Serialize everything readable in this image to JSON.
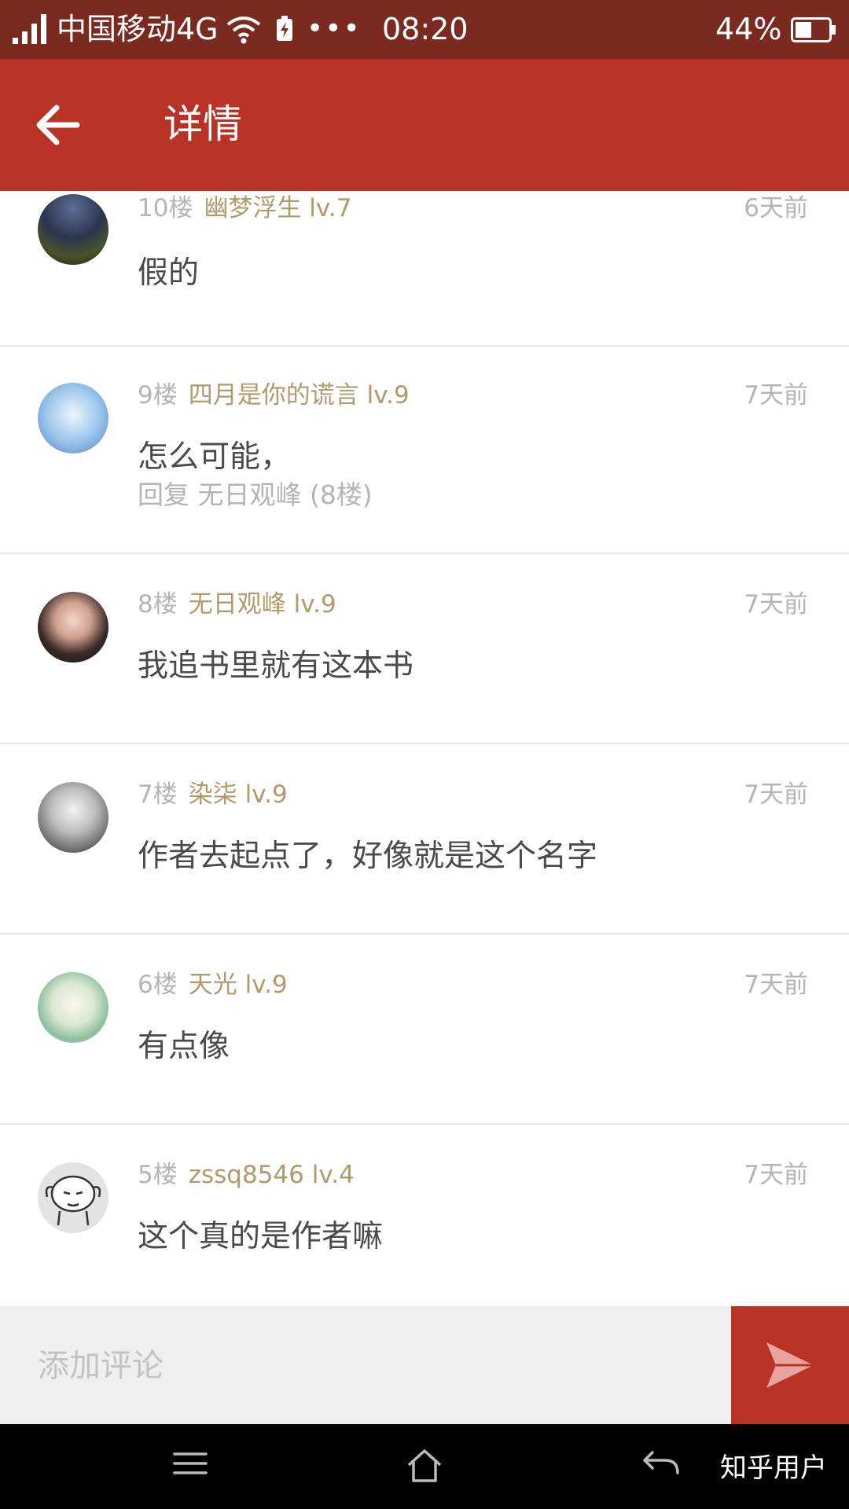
{
  "status_bar": {
    "carrier": "中国移动4G",
    "dots": "•••",
    "time": "08:20",
    "battery": "44%"
  },
  "app_bar": {
    "title": "详情"
  },
  "comments": [
    {
      "floor": "10楼",
      "user": "幽梦浮生 lv.7",
      "time": "6天前",
      "text": "假的"
    },
    {
      "floor": "9楼",
      "user": "四月是你的谎言 lv.9",
      "time": "7天前",
      "text": "怎么可能，",
      "reply": "回复 无日观峰 (8楼)"
    },
    {
      "floor": "8楼",
      "user": "无日观峰 lv.9",
      "time": "7天前",
      "text": "我追书里就有这本书"
    },
    {
      "floor": "7楼",
      "user": "染柒 lv.9",
      "time": "7天前",
      "text": "作者去起点了，好像就是这个名字"
    },
    {
      "floor": "6楼",
      "user": "天光 lv.9",
      "time": "7天前",
      "text": "有点像"
    },
    {
      "floor": "5楼",
      "user": "zssq8546 lv.4",
      "time": "7天前",
      "text": "这个真的是作者嘛"
    }
  ],
  "comment_input": {
    "placeholder": "添加评论"
  },
  "watermark": "知乎用户",
  "colors": {
    "accent": "#b83225",
    "status_bar": "#7a2a1e",
    "username": "#b19a6b",
    "muted": "#b5b5b5"
  }
}
